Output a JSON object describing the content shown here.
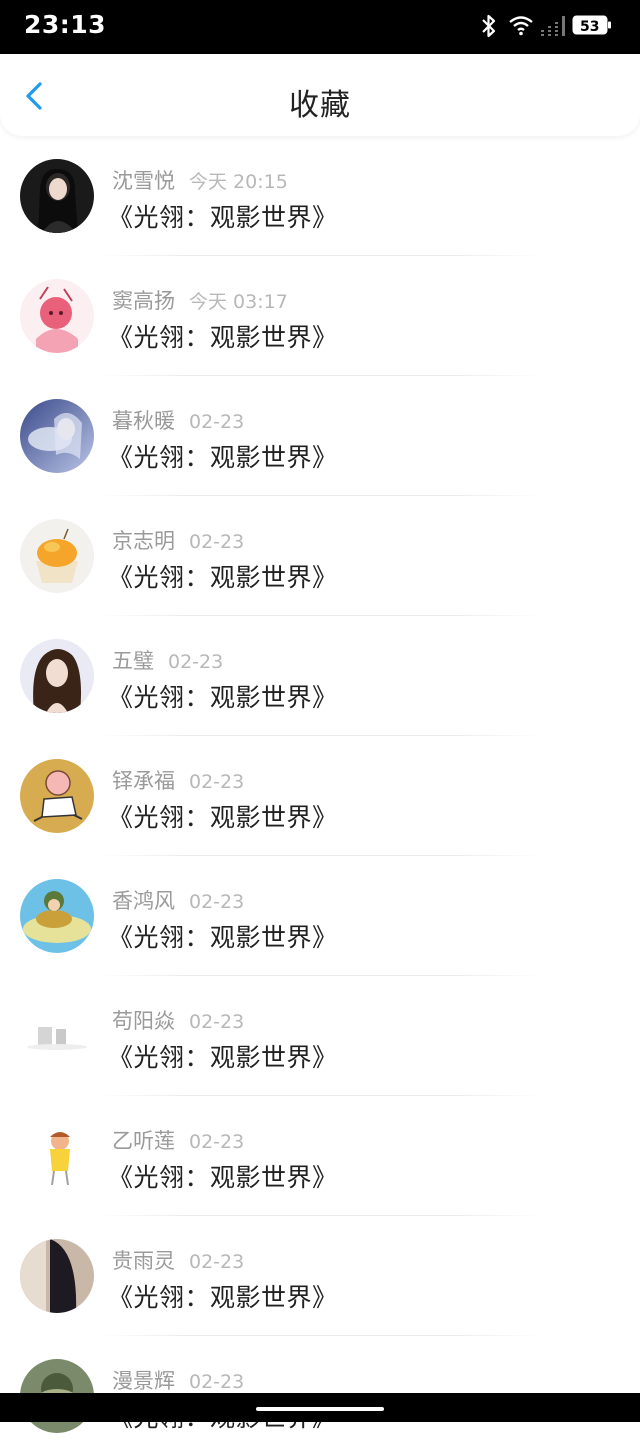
{
  "status_bar": {
    "time": "23:13",
    "battery": "53"
  },
  "header": {
    "title": "收藏"
  },
  "items": [
    {
      "name": "沈雪悦",
      "time": "今天 20:15",
      "subject": "《光翎：观影世界》"
    },
    {
      "name": "窦高扬",
      "time": "今天 03:17",
      "subject": "《光翎：观影世界》"
    },
    {
      "name": "暮秋暖",
      "time": "02-23",
      "subject": "《光翎：观影世界》"
    },
    {
      "name": "京志明",
      "time": "02-23",
      "subject": "《光翎：观影世界》"
    },
    {
      "name": "五璧",
      "time": "02-23",
      "subject": "《光翎：观影世界》"
    },
    {
      "name": "铎承福",
      "time": "02-23",
      "subject": "《光翎：观影世界》"
    },
    {
      "name": "香鸿风",
      "time": "02-23",
      "subject": "《光翎：观影世界》"
    },
    {
      "name": "苟阳焱",
      "time": "02-23",
      "subject": "《光翎：观影世界》"
    },
    {
      "name": "乙听莲",
      "time": "02-23",
      "subject": "《光翎：观影世界》"
    },
    {
      "name": "贵雨灵",
      "time": "02-23",
      "subject": "《光翎：观影世界》"
    },
    {
      "name": "漫景辉",
      "time": "02-23",
      "subject": "《光翎：观影世界》"
    }
  ],
  "colors": {
    "accent": "#1e9bf0",
    "name_text": "#9a9a9a",
    "time_text": "#b8b8b8",
    "subject_text": "#222222"
  }
}
